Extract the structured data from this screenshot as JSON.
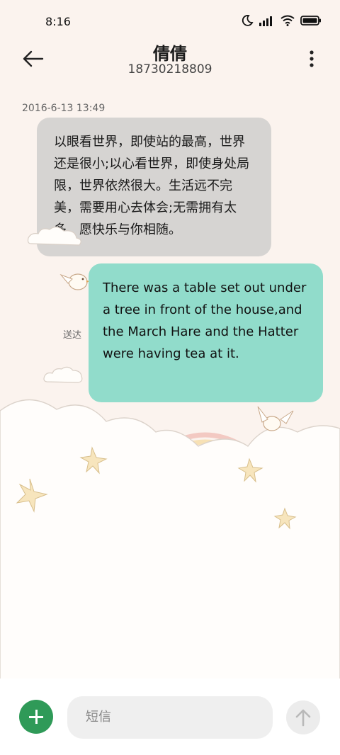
{
  "status": {
    "time": "8:16",
    "icons": [
      "moon-icon",
      "signal-icon",
      "wifi-icon",
      "battery-icon"
    ]
  },
  "header": {
    "name": "倩倩",
    "number": "18730218809",
    "icons": [
      "back-arrow-icon",
      "more-icon"
    ]
  },
  "thread": {
    "timestamp": "2016-6-13 13:49",
    "incoming_text": "以眼看世界，即使站的最高，世界还是很小;以心看世界，即使身处局限，世界依然很大。生活远不完美，需要用心去体会;无需拥有太多，愿快乐与你相随。",
    "outgoing_text": "There was a table set out under a tree in front of the house,and the March Hare and the Hatter were having tea at it.",
    "delivery_status": "送达"
  },
  "composer": {
    "placeholder": "短信",
    "icons": [
      "plus-icon",
      "send-arrow-icon"
    ]
  },
  "colors": {
    "incoming": "#d6d4d2",
    "outgoing": "#91dccb",
    "add_button": "#2f9a58",
    "background": "#fbf3ee"
  }
}
